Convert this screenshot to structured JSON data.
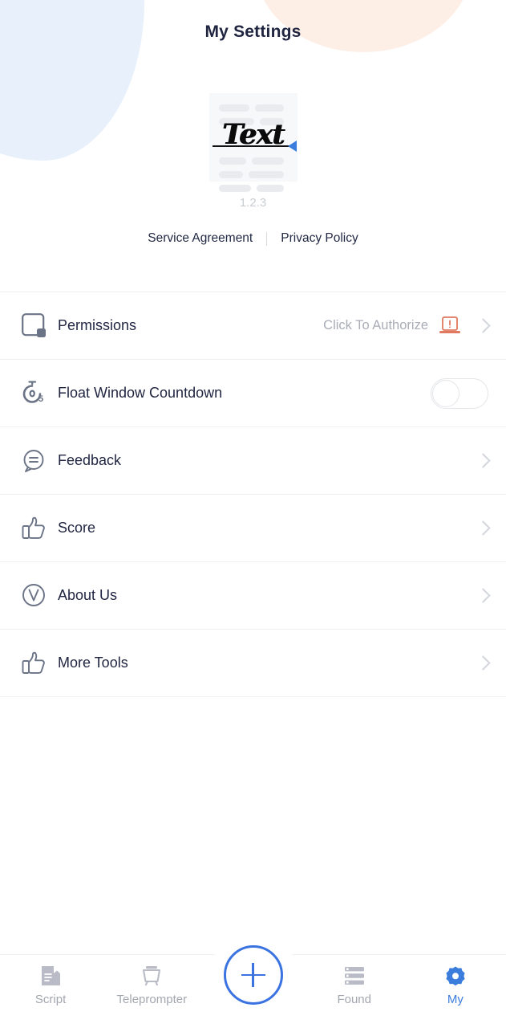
{
  "header": {
    "title": "My Settings",
    "logo_text": "Text",
    "version": "1.2.3",
    "links": [
      {
        "label": "Service Agreement",
        "name": "service-agreement-link"
      },
      {
        "label": "Privacy Policy",
        "name": "privacy-policy-link"
      }
    ]
  },
  "colors": {
    "accent_blue": "#3b7ddd",
    "title_navy": "#1f2440",
    "blob_blue": "#e8f1fb",
    "blob_orange": "#fdeee6",
    "alert_orange": "#e0795f",
    "muted_gray": "#a9adb6"
  },
  "settings": {
    "rows": [
      {
        "label": "Permissions",
        "icon": "permissions-square-icon",
        "value": "Click To Authorize",
        "trailing": "alert-laptop-icon",
        "control": "chevron"
      },
      {
        "label": "Float Window Countdown",
        "icon": "stopwatch-5-icon",
        "value": "",
        "trailing": "",
        "control": "toggle",
        "toggle_on": false
      },
      {
        "label": "Feedback",
        "icon": "speech-bubble-icon",
        "value": "",
        "trailing": "",
        "control": "chevron"
      },
      {
        "label": "Score",
        "icon": "thumbs-up-icon",
        "value": "",
        "trailing": "",
        "control": "chevron"
      },
      {
        "label": "About Us",
        "icon": "circle-v-icon",
        "value": "",
        "trailing": "",
        "control": "chevron"
      },
      {
        "label": "More Tools",
        "icon": "thumbs-up-icon",
        "value": "",
        "trailing": "",
        "control": "chevron"
      }
    ]
  },
  "tabbar": {
    "tabs": [
      {
        "label": "Script",
        "icon": "script-document-icon",
        "active": false
      },
      {
        "label": "Teleprompter",
        "icon": "teleprompter-icon",
        "active": false
      },
      {
        "label": "Found",
        "icon": "list-found-icon",
        "active": false
      },
      {
        "label": "My",
        "icon": "gear-icon",
        "active": true
      }
    ],
    "fab": {
      "name": "add-button",
      "icon": "plus-icon"
    }
  }
}
